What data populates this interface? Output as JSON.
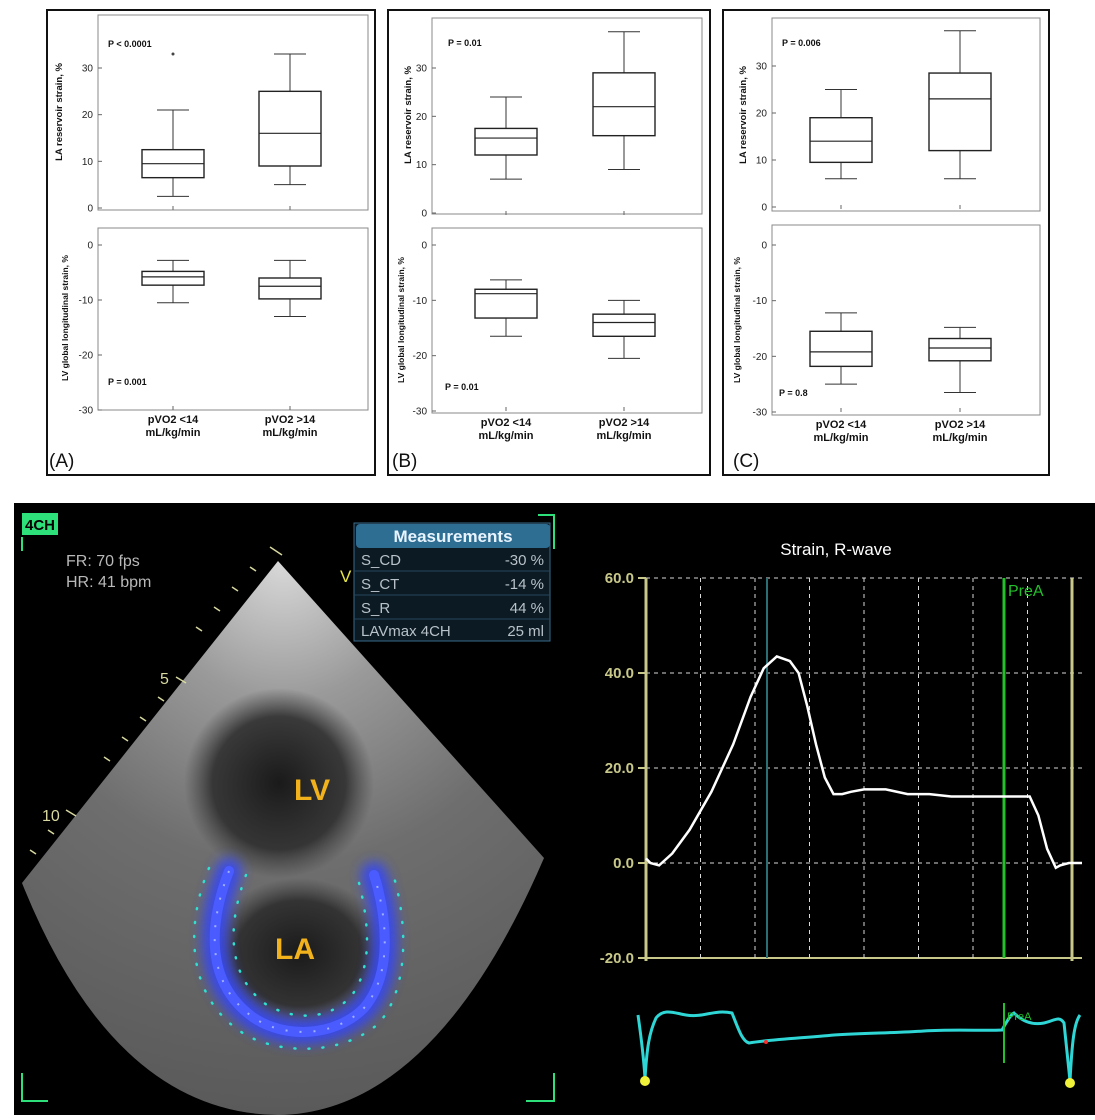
{
  "panels": [
    {
      "label": "(A)",
      "top_ylabel": "LA reservoir strain, %",
      "top_p": "P < 0.0001",
      "top_yticks": [
        "0",
        "10",
        "20",
        "30"
      ],
      "bottom_ylabel": "LV global longitudinal strain, %",
      "bottom_p": "P = 0.001",
      "bottom_yticks": [
        "0",
        "-10",
        "-20",
        "-30"
      ],
      "xlabels": [
        [
          "pVO2 <14",
          "mL/kg/min"
        ],
        [
          "pVO2 >14",
          "mL/kg/min"
        ]
      ]
    },
    {
      "label": "(B)",
      "top_ylabel": "LA reservoir strain, %",
      "top_p": "P = 0.01",
      "top_yticks": [
        "0",
        "10",
        "20",
        "30"
      ],
      "bottom_ylabel": "LV global longitudinal strain, %",
      "bottom_p": "P = 0.01",
      "bottom_yticks": [
        "0",
        "-10",
        "-20",
        "-30"
      ],
      "xlabels": [
        [
          "pVO2 <14",
          "mL/kg/min"
        ],
        [
          "pVO2 >14",
          "mL/kg/min"
        ]
      ]
    },
    {
      "label": "(C)",
      "top_ylabel": "LA reservoir strain, %",
      "top_p": "P = 0.006",
      "top_yticks": [
        "0",
        "10",
        "20",
        "30"
      ],
      "bottom_ylabel": "LV global longitudinal strain, %",
      "bottom_p": "P = 0.8",
      "bottom_yticks": [
        "0",
        "-10",
        "-20",
        "-30"
      ],
      "xlabels": [
        [
          "pVO2 <14",
          "mL/kg/min"
        ],
        [
          "pVO2 >14",
          "mL/kg/min"
        ]
      ]
    }
  ],
  "chart_data": [
    {
      "type": "box",
      "panel": "A-top",
      "ylim": [
        0,
        36
      ],
      "categories": [
        "pVO2 <14 mL/kg/min",
        "pVO2 >14 mL/kg/min"
      ],
      "boxes": [
        {
          "min": 2.5,
          "q1": 6.5,
          "median": 9.5,
          "q3": 12.5,
          "max": 21,
          "outliers": [
            33
          ]
        },
        {
          "min": 5,
          "q1": 9,
          "median": 16,
          "q3": 25,
          "max": 33,
          "outliers": []
        }
      ]
    },
    {
      "type": "box",
      "panel": "A-bottom",
      "ylim": [
        -30,
        2
      ],
      "categories": [
        "pVO2 <14 mL/kg/min",
        "pVO2 >14 mL/kg/min"
      ],
      "boxes": [
        {
          "min": -10.5,
          "q1": -7.3,
          "median": -5.8,
          "q3": -4.8,
          "max": -2.8,
          "outliers": []
        },
        {
          "min": -13,
          "q1": -9.8,
          "median": -7.5,
          "q3": -6,
          "max": -2.8,
          "outliers": []
        }
      ]
    },
    {
      "type": "box",
      "panel": "B-top",
      "ylim": [
        0,
        38
      ],
      "categories": [
        "pVO2 <14 mL/kg/min",
        "pVO2 >14 mL/kg/min"
      ],
      "boxes": [
        {
          "min": 7,
          "q1": 12,
          "median": 15.5,
          "q3": 17.5,
          "max": 24,
          "outliers": []
        },
        {
          "min": 9,
          "q1": 16,
          "median": 22,
          "q3": 29,
          "max": 37.5,
          "outliers": []
        }
      ]
    },
    {
      "type": "box",
      "panel": "B-bottom",
      "ylim": [
        -30,
        2
      ],
      "categories": [
        "pVO2 <14 mL/kg/min",
        "pVO2 >14 mL/kg/min"
      ],
      "boxes": [
        {
          "min": -16.5,
          "q1": -13.2,
          "median": -8.8,
          "q3": -8,
          "max": -6.3,
          "outliers": []
        },
        {
          "min": -20.5,
          "q1": -16.5,
          "median": -14,
          "q3": -12.5,
          "max": -10,
          "outliers": []
        }
      ]
    },
    {
      "type": "box",
      "panel": "C-top",
      "ylim": [
        0,
        38
      ],
      "categories": [
        "pVO2 <14 mL/kg/min",
        "pVO2 >14 mL/kg/min"
      ],
      "boxes": [
        {
          "min": 6,
          "q1": 9.5,
          "median": 14,
          "q3": 19,
          "max": 25,
          "outliers": []
        },
        {
          "min": 6,
          "q1": 12,
          "median": 23,
          "q3": 28.5,
          "max": 37.5,
          "outliers": []
        }
      ]
    },
    {
      "type": "box",
      "panel": "C-bottom",
      "ylim": [
        -30,
        2
      ],
      "categories": [
        "pVO2 <14 mL/kg/min",
        "pVO2 >14 mL/kg/min"
      ],
      "boxes": [
        {
          "min": -25,
          "q1": -21.8,
          "median": -19.2,
          "q3": -15.5,
          "max": -12.2,
          "outliers": []
        },
        {
          "min": -26.5,
          "q1": -20.8,
          "median": -18.5,
          "q3": -16.8,
          "max": -14.8,
          "outliers": []
        }
      ]
    },
    {
      "type": "line",
      "panel": "strain-graph",
      "title": "Strain, R-wave",
      "ylim": [
        -20,
        60
      ],
      "yticks": [
        "60.0",
        "40.0",
        "20.0",
        "0.0",
        "-20.0"
      ],
      "xlim": [
        0,
        100
      ],
      "marker": "PreA",
      "x": [
        0,
        1,
        3,
        6,
        10,
        15,
        20,
        24,
        27,
        30,
        33,
        35,
        37,
        39,
        41,
        43,
        45,
        47,
        50,
        55,
        60,
        65,
        70,
        75,
        80,
        85,
        88,
        90,
        92,
        94,
        95,
        97,
        100
      ],
      "y": [
        1,
        0,
        -0.5,
        2,
        7,
        15,
        25,
        35,
        41,
        43.5,
        42.5,
        40,
        33,
        25,
        18,
        14.5,
        14.5,
        15,
        15.5,
        15.5,
        14.5,
        14.5,
        14,
        14,
        14,
        14,
        14,
        10,
        3,
        -1,
        -0.5,
        0,
        0
      ]
    }
  ],
  "echo": {
    "view_label": "4CH",
    "fr": "FR: 70 fps",
    "hr": "HR: 41 bpm",
    "depth_marks": [
      "5",
      "10"
    ],
    "v_label": "V",
    "lv_label": "LV",
    "la_label": "LA",
    "measurements_title": "Measurements",
    "measurements": [
      {
        "name": "S_CD",
        "value": "-30 %"
      },
      {
        "name": "S_CT",
        "value": "-14 %"
      },
      {
        "name": "S_R",
        "value": "44 %"
      },
      {
        "name": "LAVmax 4CH",
        "value": "25 ml"
      }
    ],
    "ecg_marker": "PreA"
  },
  "colors": {
    "graph_axis": "#c8c88a",
    "curve": "#ffffff",
    "prea_line": "#22c02a",
    "ecg": "#2fd6d6",
    "tracking": "#3344ff",
    "label_yellow": "#f2b21c"
  }
}
